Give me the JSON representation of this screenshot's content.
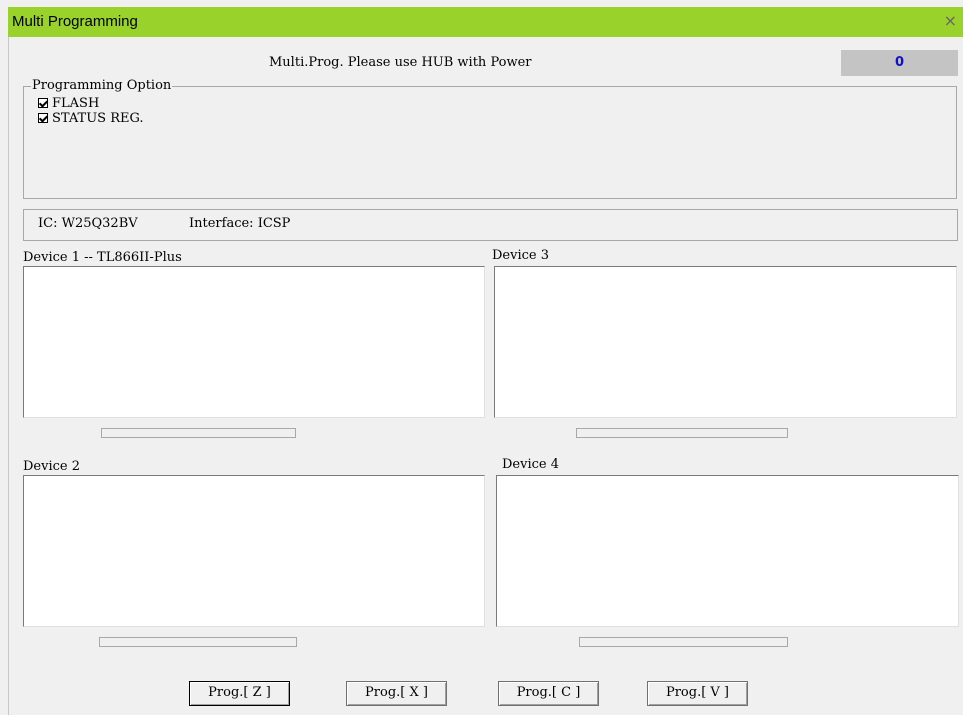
{
  "window": {
    "title": "Multi Programming",
    "close_glyph": "×"
  },
  "header": {
    "message": "Multi.Prog. Please use HUB with Power",
    "counter": "0"
  },
  "programming_option": {
    "label": "Programming Option",
    "options": [
      {
        "label": "FLASH",
        "checked": true
      },
      {
        "label": "STATUS REG.",
        "checked": true
      }
    ]
  },
  "info": {
    "ic": "IC: W25Q32BV",
    "interface": "Interface: ICSP"
  },
  "devices": [
    {
      "label": "Device 1 -- TL866II-Plus",
      "progress": 0
    },
    {
      "label": "Device 2",
      "progress": 0
    },
    {
      "label": "Device 3",
      "progress": 0
    },
    {
      "label": "Device 4",
      "progress": 0
    }
  ],
  "buttons": [
    {
      "label": "Prog.[ Z ]"
    },
    {
      "label": "Prog.[ X ]"
    },
    {
      "label": "Prog.[ C ]"
    },
    {
      "label": "Prog.[ V ]"
    }
  ],
  "colors": {
    "titlebar": "#9ad22c",
    "counter_text": "#1010c8"
  }
}
